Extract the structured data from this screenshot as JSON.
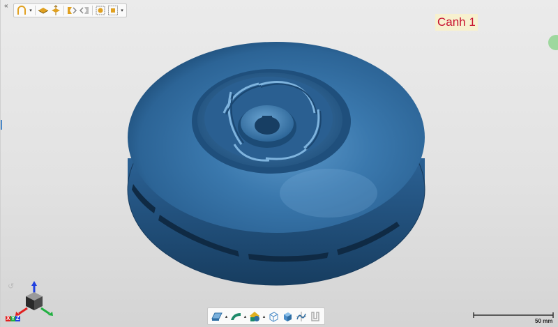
{
  "viewport": {
    "title_label": "Canh 1",
    "title_color": "#c8102e",
    "title_bg": "#f7f1cf",
    "background": "#e6e6e6"
  },
  "top_toolbar": {
    "collapse_icon": "double-chevron-left-icon",
    "buttons": [
      {
        "name": "shell-view-icon",
        "dropdown": true
      },
      {
        "name": "section-plane-icon",
        "dropdown": false
      },
      {
        "name": "section-plane-flip-icon",
        "dropdown": false
      },
      {
        "name": "mirror-left-icon",
        "dropdown": false
      },
      {
        "name": "mirror-right-icon",
        "dropdown": false
      },
      {
        "name": "fit-view-icon",
        "dropdown": false
      },
      {
        "name": "zoom-box-icon",
        "dropdown": true
      }
    ]
  },
  "model": {
    "description_icon": "impeller-3d-model",
    "color": "#2f6ea4"
  },
  "bottom_toolbar": {
    "buttons": [
      {
        "name": "render-mode-icon",
        "dropdown": true
      },
      {
        "name": "surface-color-icon",
        "dropdown": true
      },
      {
        "name": "material-icon",
        "dropdown": true
      },
      {
        "name": "wireframe-box-icon",
        "dropdown": false
      },
      {
        "name": "shaded-box-icon",
        "dropdown": false
      },
      {
        "name": "section-curve-icon",
        "dropdown": false
      },
      {
        "name": "cross-section-icon",
        "dropdown": false
      }
    ]
  },
  "scale": {
    "label": "50 mm"
  },
  "axis": {
    "x": "X",
    "y": "Y",
    "z": "Z",
    "x_color": "#e02020",
    "y_color": "#20b040",
    "z_color": "#2040e0"
  }
}
